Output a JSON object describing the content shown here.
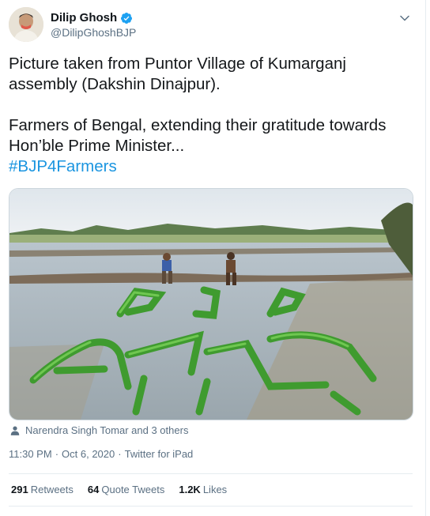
{
  "author": {
    "name": "Dilip Ghosh",
    "handle": "@DilipGhoshBJP",
    "verified_color": "#1da1f2"
  },
  "tweet": {
    "text": "Picture taken from Puntor Village of Kumarganj assembly (Dakshin Dinajpur).\n\nFarmers of Bengal, extending their gratitude towards Hon’ble Prime Minister...",
    "hashtag": "#BJP4Farmers"
  },
  "media": {
    "tagged": "Narendra Singh Tomar and 3 others"
  },
  "meta": {
    "time": "11:30 PM",
    "separator1": "·",
    "date": "Oct 6, 2020",
    "separator2": "·",
    "source": "Twitter for iPad"
  },
  "stats": {
    "retweets_count": "291",
    "retweets_label": "Retweets",
    "quotes_count": "64",
    "quotes_label": "Quote Tweets",
    "likes_count": "1.2K",
    "likes_label": "Likes"
  }
}
